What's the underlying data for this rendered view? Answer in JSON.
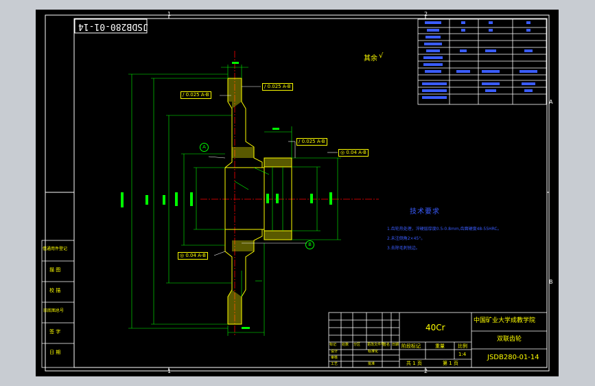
{
  "colors": {
    "frame": "#ffffff",
    "lines": "#00ffff",
    "part": "#ffff00",
    "dim": "#00ff00",
    "text": "#ffffff",
    "center": "#ff0000",
    "table": "#3a5cff"
  },
  "grid": {
    "top_1": "1",
    "top_2": "2",
    "bottom_1": "1",
    "bottom_2": "2",
    "right_a": "A",
    "right_b": "B"
  },
  "drawing_number_mirror": "JSDB280-01-14",
  "surface_rest": "其余",
  "tolerance_frames": [
    {
      "symbol": "/",
      "value": "0.025",
      "datum": "A-B"
    },
    {
      "symbol": "/",
      "value": "0.025",
      "datum": "A-B"
    },
    {
      "symbol": "/",
      "value": "0.025",
      "datum": "A-B"
    },
    {
      "symbol": "◎",
      "value": "0.04",
      "datum": "A-B"
    },
    {
      "symbol": "◎",
      "value": "0.04",
      "datum": "A-B"
    }
  ],
  "datums": {
    "a": "A",
    "b": "B"
  },
  "tech_title": "技术要求",
  "tech_notes": [
    "1.齿轮热处理，淬硬层厚度0.5-0.8mm,齿面硬度48-55HRC。",
    "2.未注倒角2×45°。",
    "3.去除毛刺锐边。"
  ],
  "left_box": [
    "借通用件登记",
    "描 图",
    "校 描",
    "旧底图总号",
    "签 字",
    "日 期"
  ],
  "title_block": {
    "material": "40Cr",
    "school": "中国矿业大学成教学院",
    "part_name": "双联齿轮",
    "drawing_no": "JSDB280-01-14",
    "row_headers": [
      "标记",
      "处数",
      "分区",
      "更改文件号",
      "签名",
      "日期"
    ],
    "row2": [
      "设计",
      "",
      "标准化"
    ],
    "row3": [
      "审核",
      "",
      ""
    ],
    "row4": [
      "工艺",
      "",
      "批准"
    ],
    "stage_label": "阶段标记",
    "weight_label": "重量",
    "scale_label": "比例",
    "scale": "1:4",
    "sheets_label": "共 1 页",
    "sheet_label": "第 1 页"
  }
}
